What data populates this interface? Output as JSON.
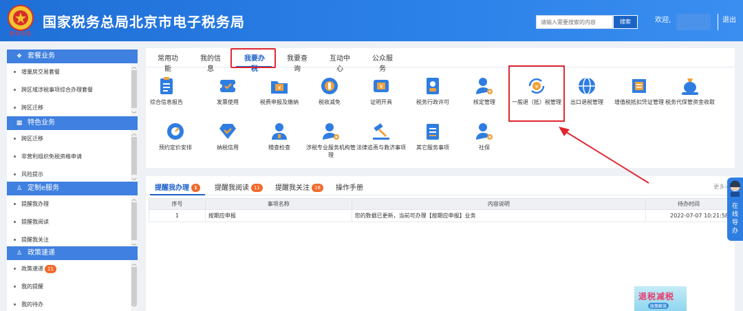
{
  "header": {
    "title": "国家税务总局北京市电子税务局",
    "seal_text": "税务总局",
    "search_placeholder": "请输入需要搜索的内容",
    "search_label": "搜索",
    "welcome": "欢迎,",
    "separator": "|",
    "logout": "退出"
  },
  "sidebar": {
    "panels": [
      {
        "title": "套餐业务",
        "icon": "layers-icon",
        "items": [
          "增量房交易套餐",
          "跨区域涉税事项综合办理套餐",
          "跨区迁移"
        ]
      },
      {
        "title": "特色业务",
        "icon": "grid-icon",
        "items": [
          "跨区迁移",
          "非营利组织免税资格申请",
          "风险提示"
        ]
      },
      {
        "title": "定制e服务",
        "icon": "user-icon",
        "items": [
          "提醒我办理",
          "提醒我阅读",
          "提醒我关注"
        ]
      },
      {
        "title": "政策速递",
        "icon": "user-icon",
        "items": [
          "政策速递",
          "我的提醒",
          "我的待办"
        ],
        "badge": "11"
      }
    ]
  },
  "main": {
    "tabs": [
      "常用功能",
      "我的信息",
      "我要办税",
      "我要查询",
      "互动中心",
      "公众服务"
    ],
    "active_tab": "我要办税",
    "services_row1": [
      {
        "label": "综合信息报告",
        "icon": "clipboard-icon"
      },
      {
        "label": "发票使用",
        "icon": "ticket-icon"
      },
      {
        "label": "税费申报及缴纳",
        "icon": "folder-yuan-icon"
      },
      {
        "label": "税收减免",
        "icon": "coin-icon"
      },
      {
        "label": "证明开具",
        "icon": "yuan-ticket-icon"
      },
      {
        "label": "税务行政许可",
        "icon": "id-card-icon"
      },
      {
        "label": "核定管理",
        "icon": "person-gear-icon"
      },
      {
        "label": "一般退（抵）税管理",
        "icon": "yuan-refresh-icon"
      },
      {
        "label": "出口退税管理",
        "icon": "globe-icon"
      },
      {
        "label": "增值税抵扣凭证管理",
        "icon": "invoice-icon"
      },
      {
        "label": "税务代保管资金收取",
        "icon": "money-bag-icon"
      }
    ],
    "services_row2": [
      {
        "label": "预约定价安排",
        "icon": "gauge-icon"
      },
      {
        "label": "纳税信用",
        "icon": "diamond-icon"
      },
      {
        "label": "稽查检查",
        "icon": "person-icon"
      },
      {
        "label": "涉税专业服务机构管理",
        "icon": "person-gear-icon"
      },
      {
        "label": "法律追责与救济事项",
        "icon": "gavel-icon"
      },
      {
        "label": "其它服务事项",
        "icon": "list-icon"
      },
      {
        "label": "社保",
        "icon": "person-gear-icon"
      }
    ]
  },
  "reminders": {
    "tabs": [
      {
        "label": "提醒我办理",
        "count": "1"
      },
      {
        "label": "提醒我阅读",
        "count": "11"
      },
      {
        "label": "提醒我关注",
        "count": "16"
      },
      {
        "label": "操作手册",
        "count": ""
      }
    ],
    "more": "更多>",
    "columns": [
      "序号",
      "事项名称",
      "内容说明",
      "待办时间"
    ],
    "rows": [
      {
        "no": "1",
        "name": "按期应申报",
        "desc": "您的数据已更新，当前可办理【按期应申报】业务",
        "time": "2022-07-07 10:21:58"
      }
    ],
    "promo_title": "退税减税",
    "promo_sub": "政策解读"
  },
  "guide": {
    "label": "在线导办"
  },
  "colors": {
    "header": "#2b80e8",
    "accent": "#1a5fc8",
    "highlight": "#e0262f",
    "badge": "#f06a2c"
  }
}
